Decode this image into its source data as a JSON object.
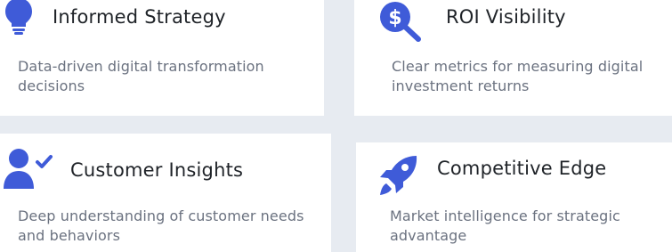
{
  "colors": {
    "accent": "#3f5bd8",
    "card": "#ffffff",
    "background": "#e7ebf1",
    "title_text": "#1f2328",
    "desc_text": "#6b7280"
  },
  "cards": [
    {
      "icon": "lightbulb-icon",
      "title": "Informed Strategy",
      "description": "Data-driven digital transformation decisions"
    },
    {
      "icon": "dollar-search-icon",
      "title": "ROI Visibility",
      "description": "Clear metrics for measuring digital investment returns"
    },
    {
      "icon": "user-check-icon",
      "title": "Customer Insights",
      "description": "Deep understanding of customer needs and behaviors"
    },
    {
      "icon": "rocket-icon",
      "title": "Competitive Edge",
      "description": "Market intelligence for strategic advantage"
    }
  ]
}
